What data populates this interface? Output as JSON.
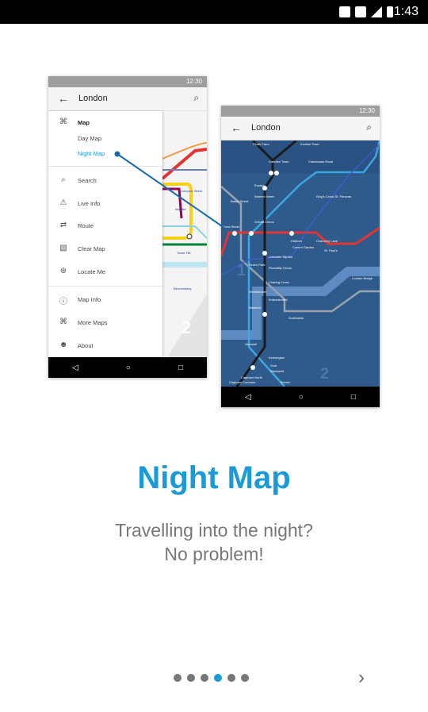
{
  "status_bar": {
    "time": "1:43"
  },
  "phone_day": {
    "time": "12:30",
    "title": "London",
    "menu": [
      {
        "label": "Map",
        "icon": "map-icon",
        "bold": true
      },
      {
        "label": "Day Map"
      },
      {
        "label": "Night Map",
        "active": true
      }
    ],
    "items": [
      {
        "label": "Search",
        "icon": "search-icon"
      },
      {
        "label": "Live Info",
        "icon": "warning-icon"
      },
      {
        "label": "Route",
        "icon": "route-icon"
      },
      {
        "label": "Clear Map",
        "icon": "clear-map-icon"
      },
      {
        "label": "Locate Me",
        "icon": "locate-icon"
      }
    ],
    "items2": [
      {
        "label": "Map Info",
        "icon": "info-icon"
      },
      {
        "label": "More Maps",
        "icon": "more-maps-icon"
      },
      {
        "label": "About",
        "icon": "about-icon"
      }
    ],
    "map_labels": [
      "Liverpool Street",
      "Aldgate",
      "Tower Hill",
      "Bermondsey",
      "2"
    ]
  },
  "phone_night": {
    "time": "12:30",
    "title": "London",
    "map_labels": [
      "Chalk Farm",
      "Camden Town",
      "Kentish Town",
      "Caledonian Road",
      "Euston",
      "King's Cross St. Pancras",
      "Warren Street",
      "Baker Street",
      "Oxford Circus",
      "Bond Street",
      "Holborn",
      "Chancery Lane",
      "St. Paul's",
      "Covent Garden",
      "Leicester Square",
      "Green Park",
      "Piccadilly Circus",
      "Charing Cross",
      "Westminster",
      "Embankment",
      "Waterloo",
      "Southwark",
      "London Bridge",
      "Vauxhall",
      "Kennington",
      "Oval",
      "Stockwell",
      "Clapham North",
      "Clapham Common",
      "Brixton",
      "2",
      "1"
    ]
  },
  "colors": {
    "accent": "#1a9ad6",
    "night_bg": "#2f5a8c",
    "dot_inactive": "#777777"
  },
  "onboarding": {
    "title": "Night Map",
    "subtitle_line1": "Travelling into the night?",
    "subtitle_line2": "No problem!",
    "page_count": 6,
    "current_page": 4
  },
  "nav_icons": {
    "back": "◁",
    "home": "○",
    "recent": "□"
  }
}
